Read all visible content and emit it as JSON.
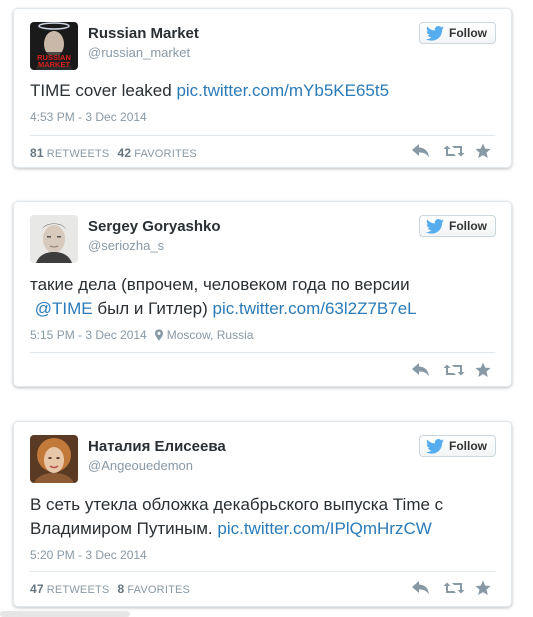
{
  "colors": {
    "link": "#2b7bb9",
    "muted": "#8899a6",
    "text": "#292f33",
    "twitter_blue": "#55acee"
  },
  "tweets": [
    {
      "name": "Russian Market",
      "handle": "@russian_market",
      "follow_label": "Follow",
      "text_plain": "TIME cover leaked ",
      "link": "pic.twitter.com/mYb5KE65t5",
      "timestamp": "4:53 PM - 3 Dec 2014",
      "retweets": "81",
      "retweets_label": "RETWEETS",
      "favorites": "42",
      "favorites_label": "FAVORITES",
      "avatar_text": "RUSSIAN MARKET"
    },
    {
      "name": "Sergey Goryashko",
      "handle": "@seriozha_s",
      "follow_label": "Follow",
      "text_line1": "такие дела (впрочем, человеком года по версии",
      "mention": "@TIME",
      "text_mid": " был и Гитлер) ",
      "link": "pic.twitter.com/63l2Z7B7eL",
      "timestamp": "5:15 PM - 3 Dec 2014",
      "location": "Moscow, Russia"
    },
    {
      "name": "Наталия Елисеева",
      "handle": "@Angeouedemon",
      "follow_label": "Follow",
      "text_line1": "В сеть утекла обложка декабрьского выпуска Time с",
      "text_line2": "Владимиром Путиным. ",
      "link": "pic.twitter.com/IPlQmHrzCW",
      "timestamp": "5:20 PM - 3 Dec 2014",
      "retweets": "47",
      "retweets_label": "RETWEETS",
      "favorites": "8",
      "favorites_label": "FAVORITES"
    }
  ]
}
